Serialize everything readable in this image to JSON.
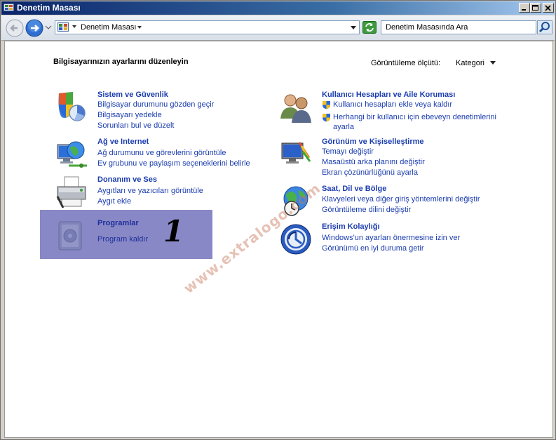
{
  "window": {
    "title": "Denetim Masası"
  },
  "address_bar": {
    "breadcrumb": "Denetim Masası",
    "search_placeholder": "Denetim Masasında Ara"
  },
  "content": {
    "heading": "Bilgisayarınızın ayarlarını düzenleyin",
    "view_by_label": "Görüntüleme ölçütü:",
    "view_by_value": "Kategori",
    "categories": [
      {
        "title": "Sistem ve Güvenlik",
        "icon": "shield-chart-icon",
        "links": [
          "Bilgisayar durumunu gözden geçir",
          "Bilgisayarı yedekle",
          "Sorunları bul ve düzelt"
        ]
      },
      {
        "title": "Ağ ve Internet",
        "icon": "network-globe-icon",
        "links": [
          "Ağ durumunu ve görevlerini görüntüle",
          "Ev grubunu ve paylaşım seçeneklerini belirle"
        ]
      },
      {
        "title": "Donanım ve Ses",
        "icon": "printer-icon",
        "links": [
          "Aygıtları ve yazıcıları görüntüle",
          "Aygıt ekle"
        ]
      },
      {
        "title": "Programlar",
        "icon": "programs-icon",
        "links": [
          "Program kaldır"
        ]
      },
      {
        "title": "Kullanıcı Hesapları ve Aile Koruması",
        "icon": "users-icon",
        "links": [
          "Kullanıcı hesapları ekle veya kaldır",
          "Herhangi bir kullanıcı için ebeveyn denetimlerini",
          "ayarla"
        ]
      },
      {
        "title": "Görünüm ve Kişiselleştirme",
        "icon": "monitor-paint-icon",
        "links": [
          "Temayı değiştir",
          "Masaüstü arka planını değiştir",
          "Ekran çözünürlüğünü ayarla"
        ]
      },
      {
        "title": "Saat, Dil ve Bölge",
        "icon": "globe-clock-icon",
        "links": [
          "Klavyeleri veya diğer giriş yöntemlerini değiştir",
          "Görüntüleme dilini değiştir"
        ]
      },
      {
        "title": "Erişim Kolaylığı",
        "icon": "accessibility-icon",
        "links": [
          "Windows'un ayarları önermesine izin ver",
          "Görünümü en iyi duruma getir"
        ]
      }
    ]
  },
  "annotation": {
    "number": "1",
    "watermark": "www.extralogo.com"
  },
  "colors": {
    "link": "#1a3cae",
    "highlight": "#6e6eb9"
  }
}
